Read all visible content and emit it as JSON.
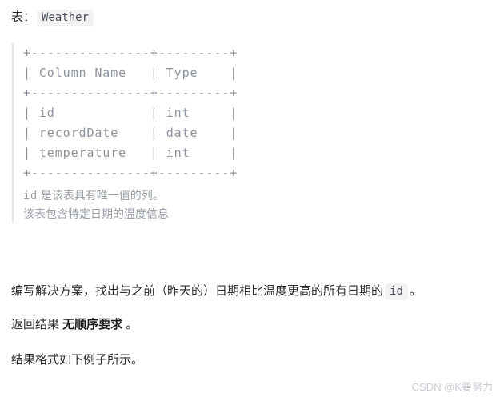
{
  "header": {
    "label": "表：",
    "table_name": "Weather"
  },
  "schema_block": {
    "ascii_table": "+---------------+---------+\n| Column Name   | Type    |\n+---------------+---------+\n| id            | int     |\n| recordDate    | date    |\n| temperature   | int     |\n+---------------+---------+",
    "columns": [
      {
        "name": "Column Name",
        "type": "Type"
      },
      {
        "name": "id",
        "type": "int"
      },
      {
        "name": "recordDate",
        "type": "date"
      },
      {
        "name": "temperature",
        "type": "int"
      }
    ],
    "notes": [
      {
        "code": "id",
        "text": " 是该表具有唯一值的列。"
      },
      {
        "code": "",
        "text": "该表包含特定日期的温度信息"
      }
    ]
  },
  "body": {
    "paragraph1_before": "编写解决方案，找出与之前（昨天的）日期相比温度更高的所有日期的",
    "paragraph1_code": "id",
    "paragraph1_after": "。",
    "paragraph2_before": "返回结果 ",
    "paragraph2_bold": "无顺序要求",
    "paragraph2_after": " 。",
    "paragraph3": "结果格式如下例子所示。"
  },
  "watermark": {
    "text": "CSDN @K要努力"
  },
  "colors": {
    "page_background": "#ffffff",
    "body_text": "#2c2c2c",
    "code_text": "#8d939d",
    "note_text": "#9aa0a8",
    "inline_code_background": "#f2f2f3",
    "inline_code_text": "#4a4f58",
    "quote_border": "#e6e6e8",
    "watermark_text": "#c9cdd2"
  }
}
